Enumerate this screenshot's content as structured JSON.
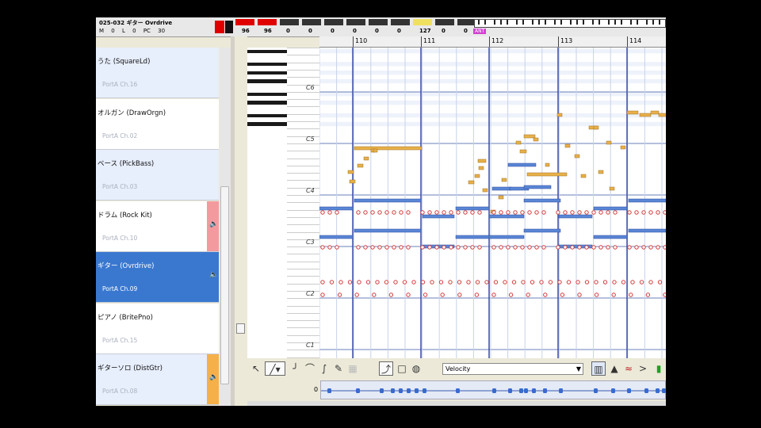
{
  "header": {
    "title": "025-032 ギター Ovrdrive",
    "sub_items": [
      "M",
      "0",
      "L",
      "0",
      "PC",
      "30"
    ],
    "meter_values": [
      "96",
      "96",
      "0",
      "0",
      "0",
      "0",
      "0",
      "0",
      "127",
      "0",
      "0"
    ],
    "ant_label": "ANT"
  },
  "ruler": {
    "measures": [
      "110",
      "111",
      "112",
      "113",
      "114"
    ]
  },
  "tracks": [
    {
      "name": "うた (SquareLd)",
      "port": "PortA Ch.16",
      "strip_color": ""
    },
    {
      "name": "オルガン (DrawOrgn)",
      "port": "PortA Ch.02",
      "strip_color": ""
    },
    {
      "name": "ベース (PickBass)",
      "port": "PortA Ch.03",
      "strip_color": ""
    },
    {
      "name": "ドラム (Rock Kit)",
      "port": "PortA Ch.10",
      "strip_color": "#f39a9e"
    },
    {
      "name": "ギター (Ovrdrive)",
      "port": "PortA Ch.09",
      "strip_color": "#3a78d0"
    },
    {
      "name": "ピアノ (BritePno)",
      "port": "PortA Ch.15",
      "strip_color": ""
    },
    {
      "name": "ギターソロ (DistGtr)",
      "port": "PortA Ch.08",
      "strip_color": "#f6b04a"
    }
  ],
  "piano": {
    "octave_labels": [
      "C6",
      "C5",
      "C4",
      "C3",
      "C2",
      "C1"
    ]
  },
  "toolbar": {
    "velocity_select": "Velocity",
    "tools": [
      "select-arrow-icon",
      "pencil-icon",
      "curve-icon",
      "line-icon",
      "freehand-icon",
      "eraser-icon",
      "snap-icon",
      "box-icon",
      "pattern-icon"
    ]
  },
  "velocity_lane": {
    "zero_label": "0"
  },
  "colors": {
    "note_orange": "#e8b04a",
    "note_blue": "#5a86d6",
    "note_red": "#d23a3a",
    "selected_track": "#3a78d0",
    "grid_bg": "#ffffff",
    "grid_alt": "#eef2fb"
  }
}
